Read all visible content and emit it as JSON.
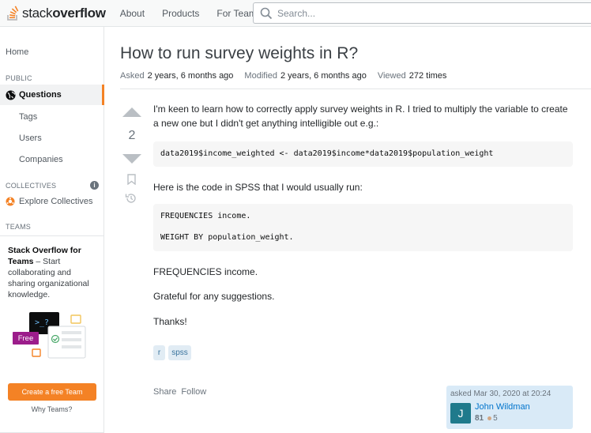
{
  "header": {
    "logo_light": "stack",
    "logo_bold": "overflow",
    "nav": [
      "About",
      "Products",
      "For Teams"
    ],
    "search_placeholder": "Search..."
  },
  "sidebar": {
    "home": "Home",
    "public_heading": "PUBLIC",
    "questions": "Questions",
    "items": [
      "Tags",
      "Users",
      "Companies"
    ],
    "collectives_heading": "COLLECTIVES",
    "explore_collectives": "Explore Collectives",
    "teams_heading": "TEAMS",
    "teams_promo_title": "Stack Overflow for Teams",
    "teams_promo_text": " – Start collaborating and sharing organizational knowledge.",
    "free_badge": "Free",
    "terminal_prompt": ">_?",
    "create_team": "Create a free Team",
    "why_teams": "Why Teams?"
  },
  "question": {
    "title": "How to run survey weights in R?",
    "asked_label": "Asked",
    "asked_value": "2 years, 6 months ago",
    "modified_label": "Modified",
    "modified_value": "2 years, 6 months ago",
    "viewed_label": "Viewed",
    "viewed_value": "272 times",
    "votes": "2",
    "body": {
      "p1": "I'm keen to learn how to correctly apply survey weights in R. I tried to multiply the variable to create a new one but I didn't get anything intelligible out e.g.:",
      "code1": "data2019$income_weighted <- data2019$income*data2019$population_weight",
      "p2": "Here is the code in SPSS that I would usually run:",
      "code2_line1": "FREQUENCIES income.",
      "code2_line2": "WEIGHT BY population_weight.",
      "p3": "FREQUENCIES income.",
      "p4": "Grateful for any suggestions.",
      "p5": "Thanks!"
    },
    "tags": [
      "r",
      "spss"
    ],
    "share": "Share",
    "follow": "Follow",
    "owner": {
      "asked": "asked Mar 30, 2020 at 20:24",
      "avatar_letter": "J",
      "name": "John Wildman",
      "reputation": "81",
      "bronze": "5"
    }
  },
  "colors": {
    "accent": "#f48225",
    "link": "#0074cc",
    "tag_bg": "#e1ecf4",
    "owner_bg": "#d9eaf7"
  }
}
